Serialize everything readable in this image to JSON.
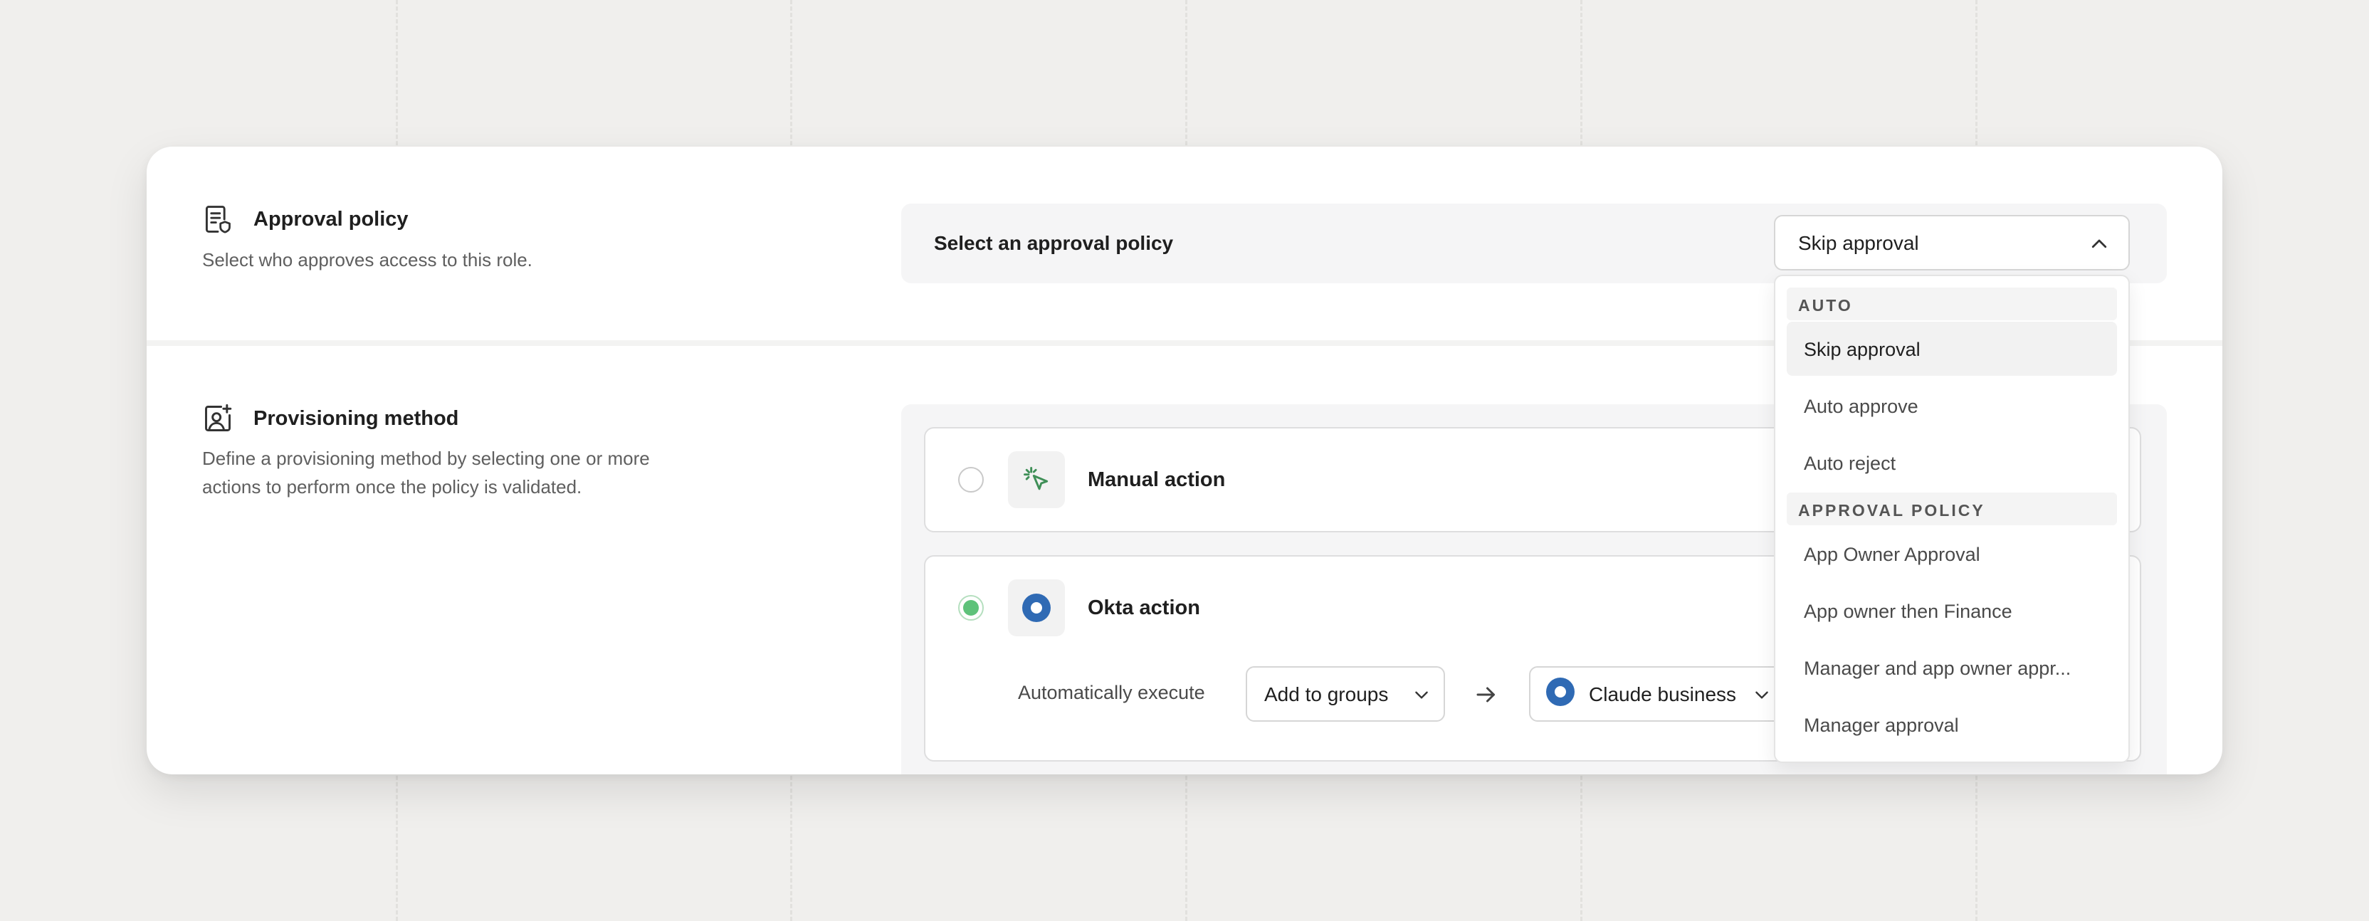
{
  "approval_section": {
    "title": "Approval policy",
    "description": "Select who approves access to this role.",
    "panel_label": "Select an approval policy",
    "selected_value": "Skip approval"
  },
  "dropdown": {
    "groups": [
      {
        "label": "AUTO",
        "items": [
          "Skip approval",
          "Auto approve",
          "Auto reject"
        ]
      },
      {
        "label": "APPROVAL POLICY",
        "items": [
          "App Owner Approval",
          "App owner then Finance",
          "Manager and app owner appr...",
          "Manager approval"
        ]
      }
    ]
  },
  "provisioning_section": {
    "title": "Provisioning method",
    "description_line1": "Define a provisioning method by selecting one or more",
    "description_line2": "actions to perform once the policy is validated.",
    "manual_action": {
      "title": "Manual action",
      "selected": false
    },
    "okta_action": {
      "title": "Okta action",
      "selected": true,
      "execute_label": "Automatically execute",
      "action_select": "Add to groups",
      "target_select": "Claude business"
    }
  },
  "colors": {
    "accent_green": "#5ec27a",
    "okta_blue": "#2f6ab4",
    "icon_green": "#3f8f57"
  }
}
